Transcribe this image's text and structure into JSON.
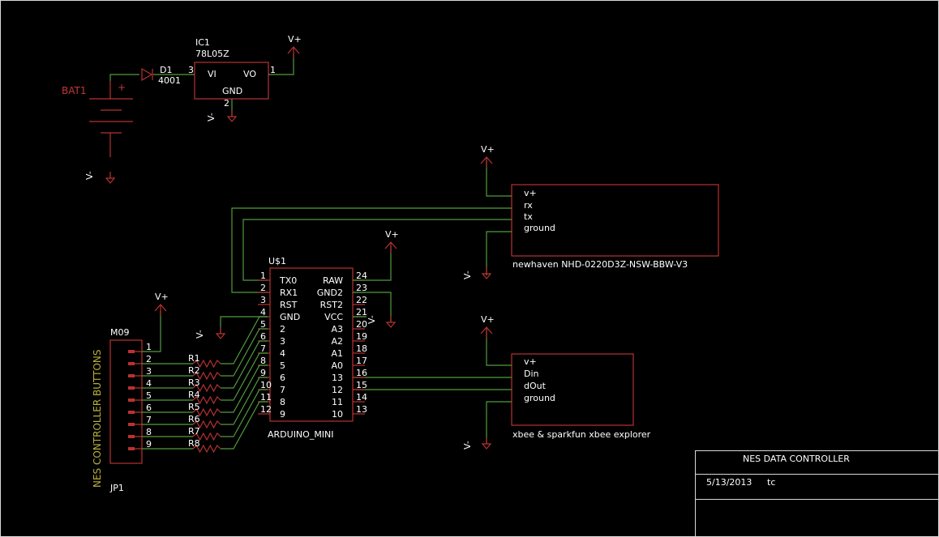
{
  "colors": {
    "background": "#000000",
    "part": "#b83232",
    "wire": "#4f9c3c",
    "text": "#ffffff",
    "name": "#b7b03a"
  },
  "title_block": {
    "title": "NES DATA CONTROLLER",
    "date": "5/13/2013",
    "author": "tc"
  },
  "ic1": {
    "name": "IC1",
    "value": "78L05Z",
    "vi": "VI",
    "vo": "VO",
    "gnd": "GND",
    "pin_in": "3",
    "pin_out": "1",
    "pin_gnd": "2"
  },
  "d1": {
    "name": "D1",
    "value": "4001"
  },
  "bat1": {
    "name": "BAT1",
    "plus": "+"
  },
  "supply": {
    "vplus": "V+",
    "vminus": "V-"
  },
  "display": {
    "pins": [
      "v+",
      "rx",
      "tx",
      "ground"
    ],
    "caption": "newhaven NHD-0220D3Z-NSW-BBW-V3"
  },
  "xbee": {
    "pins": [
      "v+",
      "Din",
      "dOut",
      "ground"
    ],
    "caption": "xbee & sparkfun xbee explorer"
  },
  "arduino": {
    "name": "U$1",
    "value": "ARDUINO_MINI",
    "left_labels": [
      "TX0",
      "RX1",
      "RST",
      "GND",
      "2",
      "3",
      "4",
      "5",
      "6",
      "7",
      "8",
      "9"
    ],
    "left_pins": [
      "1",
      "2",
      "3",
      "4",
      "5",
      "6",
      "7",
      "8",
      "9",
      "10",
      "11",
      "12"
    ],
    "right_labels": [
      "RAW",
      "GND2",
      "RST2",
      "VCC",
      "A3",
      "A2",
      "A1",
      "A0",
      "13",
      "12",
      "11",
      "10"
    ],
    "right_pins": [
      "24",
      "23",
      "22",
      "21",
      "20",
      "19",
      "18",
      "17",
      "16",
      "15",
      "14",
      "13"
    ]
  },
  "connector": {
    "name": "JP1",
    "value": "M09",
    "label": "NES CONTROLLER BUTTONS",
    "pins": [
      "1",
      "2",
      "3",
      "4",
      "5",
      "6",
      "7",
      "8",
      "9"
    ]
  },
  "resistors": [
    "R1",
    "R2",
    "R3",
    "R4",
    "R5",
    "R6",
    "R7",
    "R8"
  ]
}
